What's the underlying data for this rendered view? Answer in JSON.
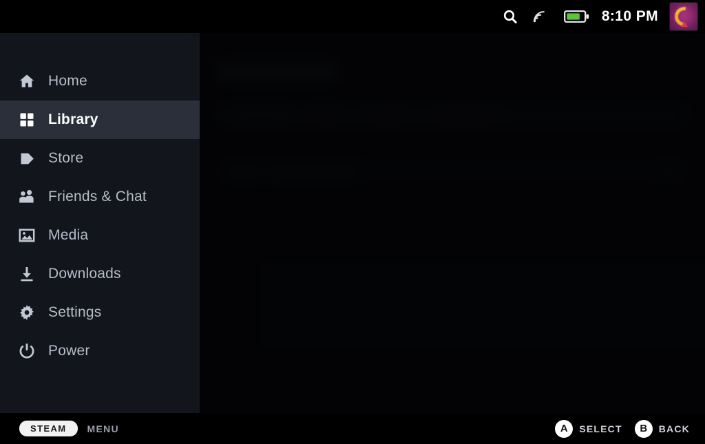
{
  "statusbar": {
    "search_icon": "search-icon",
    "wifi_icon": "wifi-icon",
    "battery_icon": "battery-icon",
    "battery_color": "#5ec23f",
    "time": "8:10 PM",
    "avatar_label": "user-avatar"
  },
  "sidebar": {
    "background": "#12151c",
    "active_background": "#2b2f3a",
    "items": [
      {
        "id": "home",
        "label": "Home",
        "icon": "home-icon",
        "active": false
      },
      {
        "id": "library",
        "label": "Library",
        "icon": "grid-icon",
        "active": true
      },
      {
        "id": "store",
        "label": "Store",
        "icon": "tag-icon",
        "active": false
      },
      {
        "id": "friends",
        "label": "Friends & Chat",
        "icon": "people-icon",
        "active": false
      },
      {
        "id": "media",
        "label": "Media",
        "icon": "image-icon",
        "active": false
      },
      {
        "id": "downloads",
        "label": "Downloads",
        "icon": "download-icon",
        "active": false
      },
      {
        "id": "settings",
        "label": "Settings",
        "icon": "gear-icon",
        "active": false
      },
      {
        "id": "power",
        "label": "Power",
        "icon": "power-icon",
        "active": false
      }
    ]
  },
  "content": {
    "state": "dimmed-blurred-background",
    "background": "#0b0d12"
  },
  "bottombar": {
    "steam_label": "STEAM",
    "menu_label": "MENU",
    "hints": [
      {
        "button": "A",
        "action": "SELECT"
      },
      {
        "button": "B",
        "action": "BACK"
      }
    ]
  }
}
